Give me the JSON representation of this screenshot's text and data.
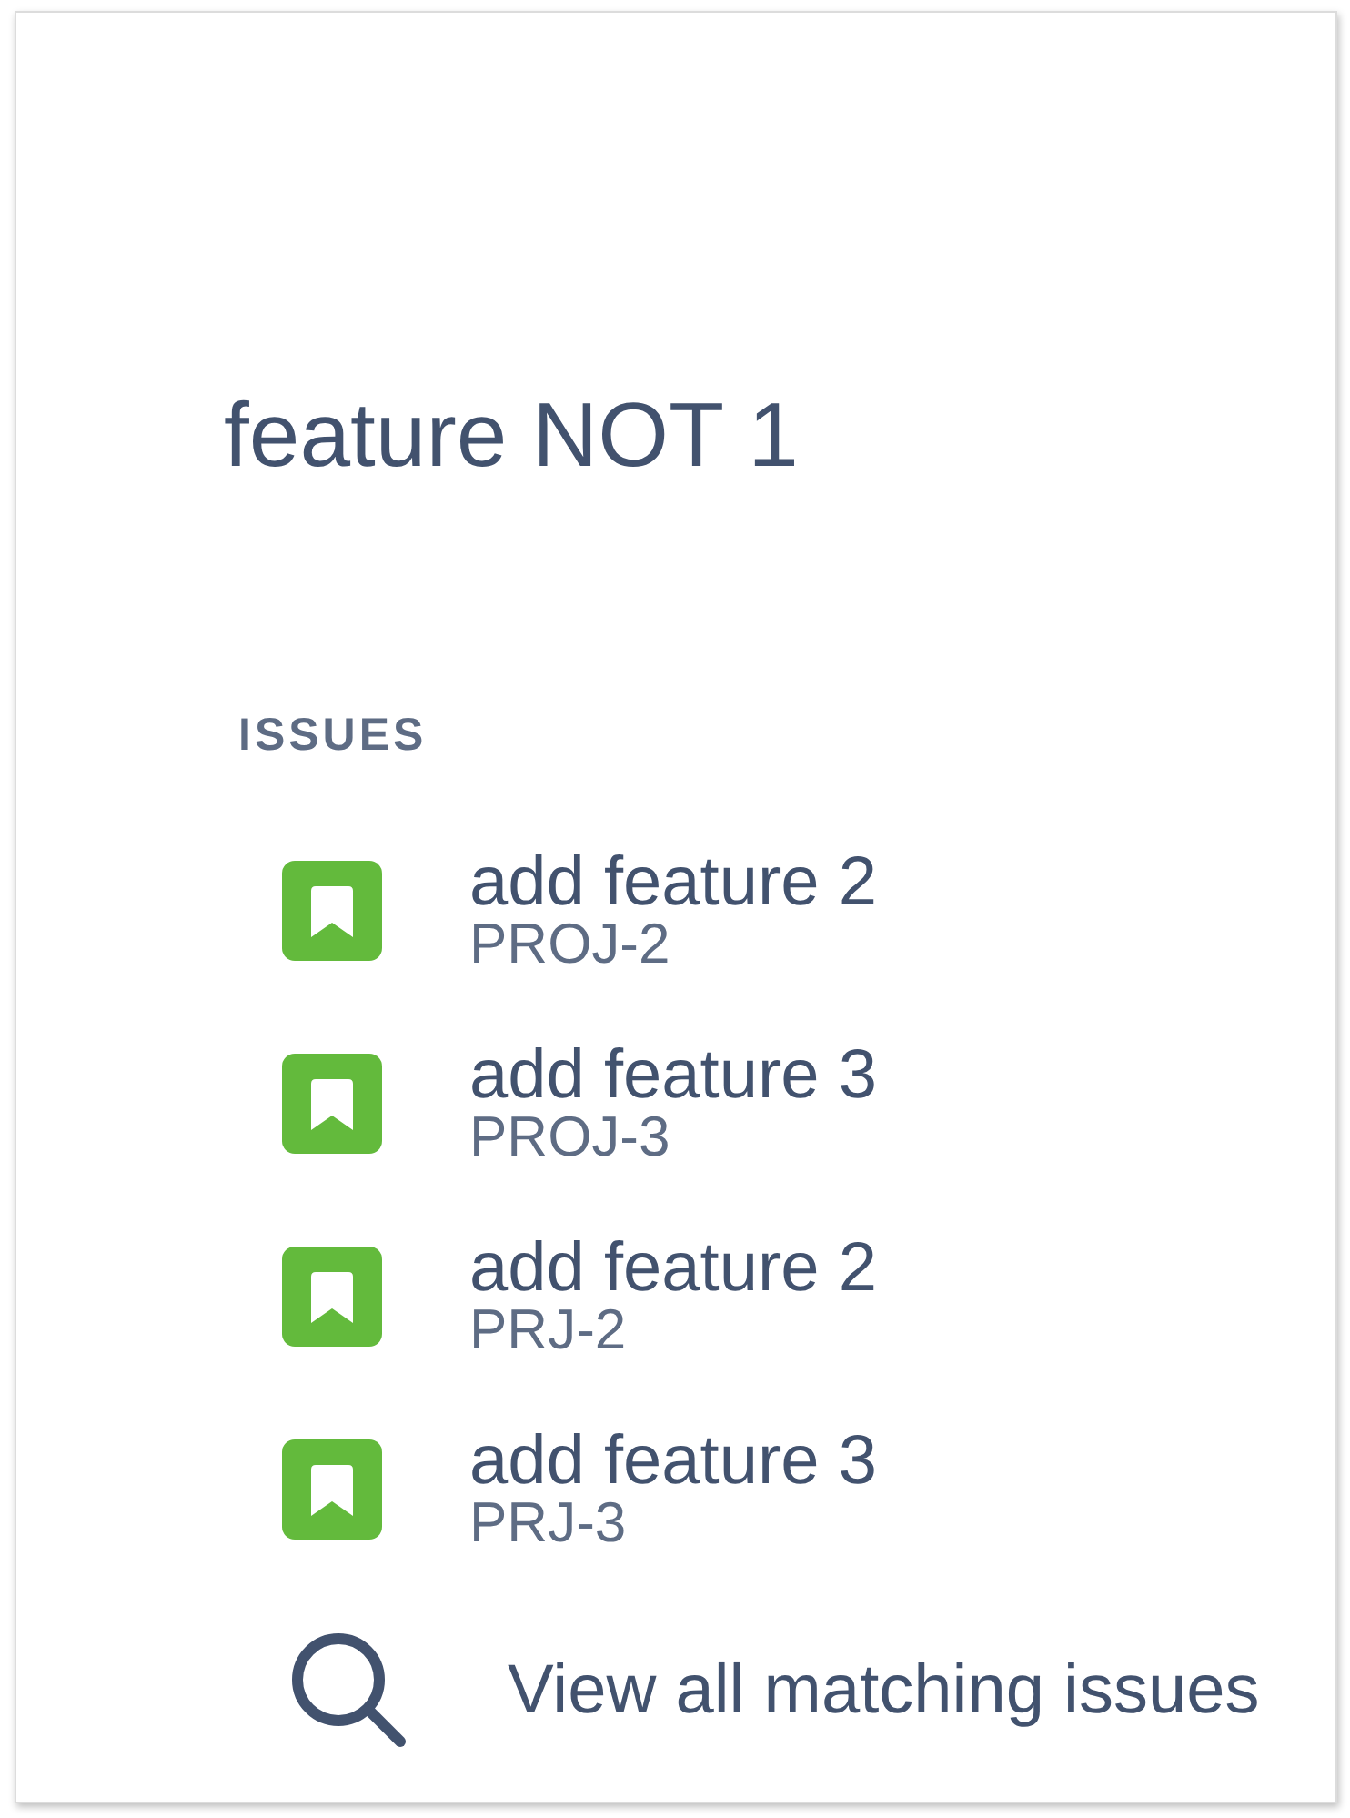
{
  "search": {
    "value": "feature NOT 1"
  },
  "issues_section": {
    "heading": "ISSUES",
    "items": [
      {
        "title": "add feature 2",
        "key": "PROJ-2"
      },
      {
        "title": "add feature 3",
        "key": "PROJ-3"
      },
      {
        "title": "add feature 2",
        "key": "PRJ-2"
      },
      {
        "title": "add feature 3",
        "key": "PRJ-3"
      }
    ]
  },
  "view_all": {
    "label": "View all matching issues"
  }
}
